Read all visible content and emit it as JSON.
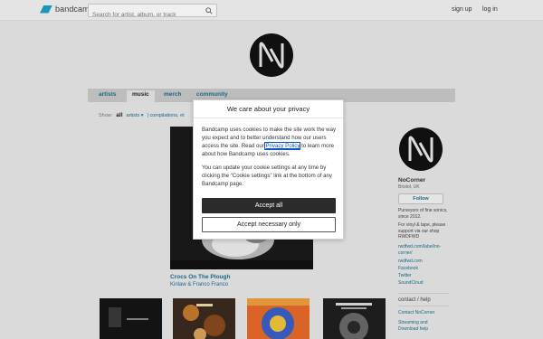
{
  "header": {
    "brand": "bandcamp",
    "search_placeholder": "Search for artist, album, or track",
    "signup": "sign up",
    "login": "log in"
  },
  "nav": {
    "tabs": [
      {
        "label": "artists"
      },
      {
        "label": "music"
      },
      {
        "label": "merch"
      },
      {
        "label": "community"
      }
    ]
  },
  "filters": {
    "label": "Show:",
    "all": "all",
    "artists": "artists ▾",
    "compilations": "| compilations, et"
  },
  "featured": {
    "title": "Crocs On The Plough",
    "artist": "Kinlaw & Franco Franco"
  },
  "sidebar": {
    "name": "NoCorner",
    "location": "Bristol, UK",
    "follow": "Follow",
    "bio": "Purveyors of fine sonics, since 2012.",
    "vinyl_note": "For vinyl & tape, please support via our shop RWDFWD",
    "links": [
      "rwdfwd.com/label/no-corner/",
      "rwdfwd.com",
      "Facebook",
      "Twitter",
      "SoundCloud"
    ],
    "contact_heading": "contact / help",
    "contact_links": [
      "Contact NoCorner",
      "Streaming and Download help"
    ]
  },
  "cookie_dialog": {
    "title": "We care about your privacy",
    "body1_before": "Bandcamp uses cookies to make the site work the way you expect and to better understand how our users access the site. Read our ",
    "body1_link": "Privacy Policy",
    "body1_after": " to learn more about how Bandcamp uses cookies.",
    "body2": "You can update your cookie settings at any time by clicking the “Cookie settings” link at the bottom of any Bandcamp page.",
    "accept_all": "Accept all",
    "accept_necessary": "Accept necessary only"
  },
  "colors": {
    "brand": "#1da0c3",
    "link": "#1d6f90",
    "accept_bg": "#2b2b2b"
  }
}
